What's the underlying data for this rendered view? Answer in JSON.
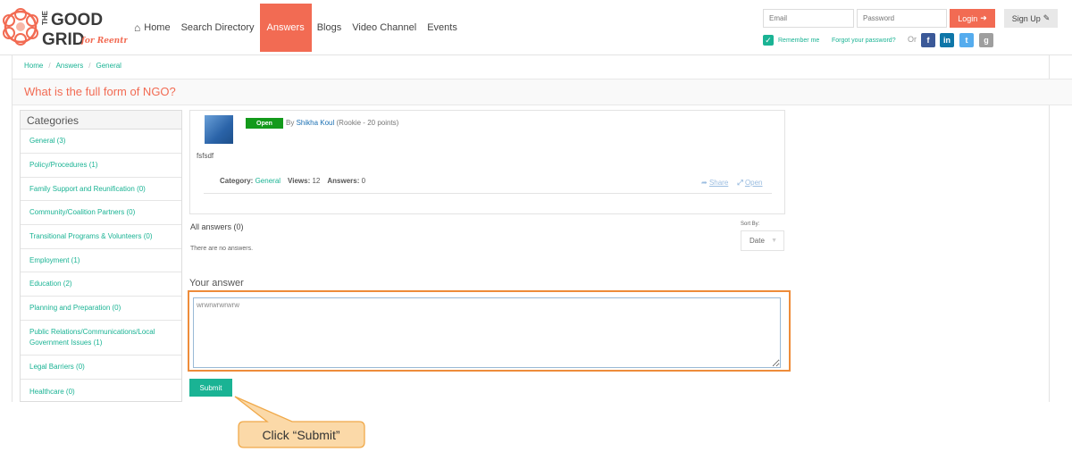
{
  "brand": {
    "line1": "THE",
    "line2": "GOOD",
    "line3": "GRID",
    "tagline": "for Reentry"
  },
  "nav": {
    "items": [
      {
        "label": "Home",
        "icon": "home-icon"
      },
      {
        "label": "Search Directory"
      },
      {
        "label": "Answers",
        "active": true
      },
      {
        "label": "Blogs"
      },
      {
        "label": "Video Channel"
      },
      {
        "label": "Events"
      }
    ]
  },
  "auth": {
    "email_placeholder": "Email",
    "password_placeholder": "Password",
    "login_label": "Login",
    "signup_label": "Sign Up",
    "remember_label": "Remember me",
    "forgot_label": "Forgot your password?",
    "or_label": "Or",
    "social": [
      {
        "name": "facebook-icon",
        "glyph": "f",
        "color": "#3b5998"
      },
      {
        "name": "linkedin-icon",
        "glyph": "in",
        "color": "#0e76a8"
      },
      {
        "name": "twitter-icon",
        "glyph": "t",
        "color": "#55acee"
      },
      {
        "name": "google-icon",
        "glyph": "g",
        "color": "#9e9e9e"
      }
    ]
  },
  "breadcrumb": [
    "Home",
    "Answers",
    "General"
  ],
  "page_title": "What is the full form of NGO?",
  "sidebar": {
    "title": "Categories",
    "items": [
      "General (3)",
      "Policy/Procedures (1)",
      "Family Support and Reunification (0)",
      "Community/Coalition Partners (0)",
      "Transitional Programs & Volunteers (0)",
      "Employment (1)",
      "Education (2)",
      "Planning and Preparation (0)",
      "Public Relations/Communications/Local Government Issues (1)",
      "Legal Barriers (0)",
      "Healthcare (0)"
    ]
  },
  "question": {
    "status": "Open",
    "by_label": "By",
    "author": "Shikha Koul",
    "rank": "(Rookie - 20 points)",
    "body": "fsfsdf",
    "category_label": "Category:",
    "category": "General",
    "views_label": "Views:",
    "views": "12",
    "answers_label": "Answers:",
    "answers": "0",
    "share_label": "Share",
    "open_label": "Open"
  },
  "answers": {
    "heading": "All answers (0)",
    "empty": "There are no answers.",
    "sort_label": "Sort By:",
    "sort_value": "Date"
  },
  "your_answer": {
    "heading": "Your answer",
    "value": "wrwrwrwrwrw",
    "submit_label": "Submit"
  },
  "callout": {
    "text": "Click “Submit”"
  },
  "colors": {
    "accent": "#f26b53",
    "teal": "#1ab394",
    "highlight": "#ee8c3a",
    "callout_fill": "#fbd9a8"
  }
}
